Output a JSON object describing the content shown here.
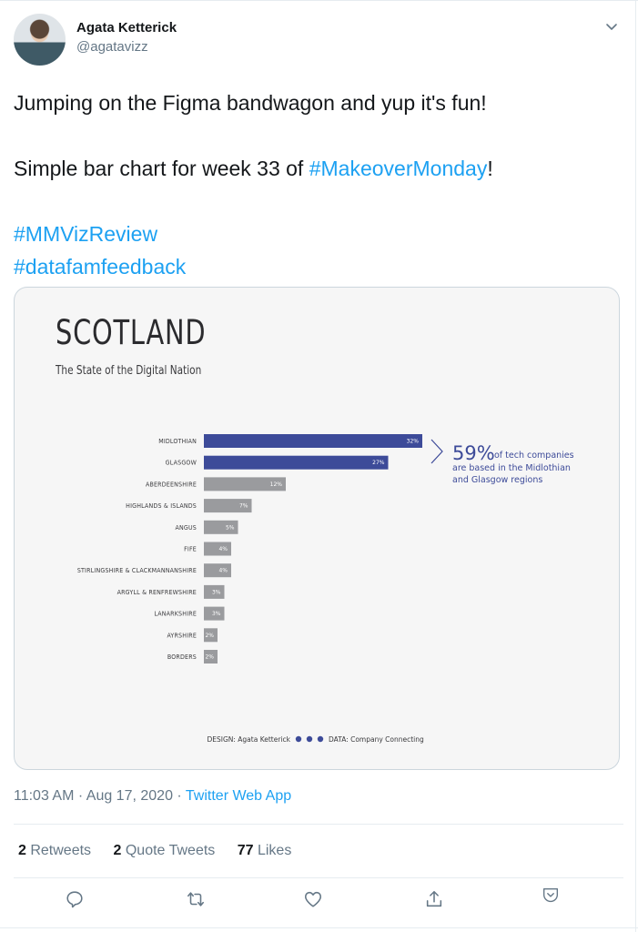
{
  "author": {
    "display_name": "Agata Ketterick",
    "handle": "@agatavizz",
    "avatar_icon": "user-avatar"
  },
  "tweet": {
    "line1": "Jumping on the Figma bandwagon and yup it's fun!",
    "line2_prefix": "Simple bar chart for week 33 of ",
    "line2_hashtag": "#MakeoverMonday",
    "line2_suffix": "!",
    "hashtag1": "#MMVizReview",
    "hashtag2": "#datafamfeedback"
  },
  "colors": {
    "highlight_bar": "#3d4b99",
    "other_bar": "#9a9b9e",
    "link": "#1da1f2"
  },
  "chart_data": {
    "type": "bar",
    "orientation": "horizontal",
    "title": "SCOTLAND",
    "subtitle": "The State of the Digital Nation",
    "categories": [
      "MIDLOTHIAN",
      "GLASGOW",
      "ABERDEENSHIRE",
      "HIGHLANDS & ISLANDS",
      "ANGUS",
      "FIFE",
      "STIRLINGSHIRE & CLACKMANNANSHIRE",
      "ARGYLL & RENFREWSHIRE",
      "LANARKSHIRE",
      "AYRSHIRE",
      "BORDERS"
    ],
    "values": [
      32,
      27,
      12,
      7,
      5,
      4,
      4,
      3,
      3,
      2,
      2
    ],
    "value_labels": [
      "32%",
      "27%",
      "12%",
      "7%",
      "5%",
      "4%",
      "4%",
      "3%",
      "3%",
      "2%",
      "2%"
    ],
    "highlighted": [
      true,
      true,
      false,
      false,
      false,
      false,
      false,
      false,
      false,
      false,
      false
    ],
    "unit": "%",
    "xlim": [
      0,
      32
    ],
    "grid": false,
    "annotation": {
      "big": "59%",
      "line1": "of tech companies",
      "line2": "are based in the Midlothian",
      "line3": "and Glasgow regions"
    },
    "credits": {
      "design": "DESIGN: Agata Ketterick",
      "data": "DATA: Company Connecting"
    }
  },
  "meta": {
    "time": "11:03 AM",
    "separator": " · ",
    "date": "Aug 17, 2020",
    "source": "Twitter Web App"
  },
  "stats": {
    "retweets_count": "2",
    "retweets_label": " Retweets",
    "quotes_count": "2",
    "quotes_label": " Quote Tweets",
    "likes_count": "77",
    "likes_label": " Likes"
  },
  "actions": [
    "reply",
    "retweet",
    "like",
    "share",
    "bookmark"
  ]
}
